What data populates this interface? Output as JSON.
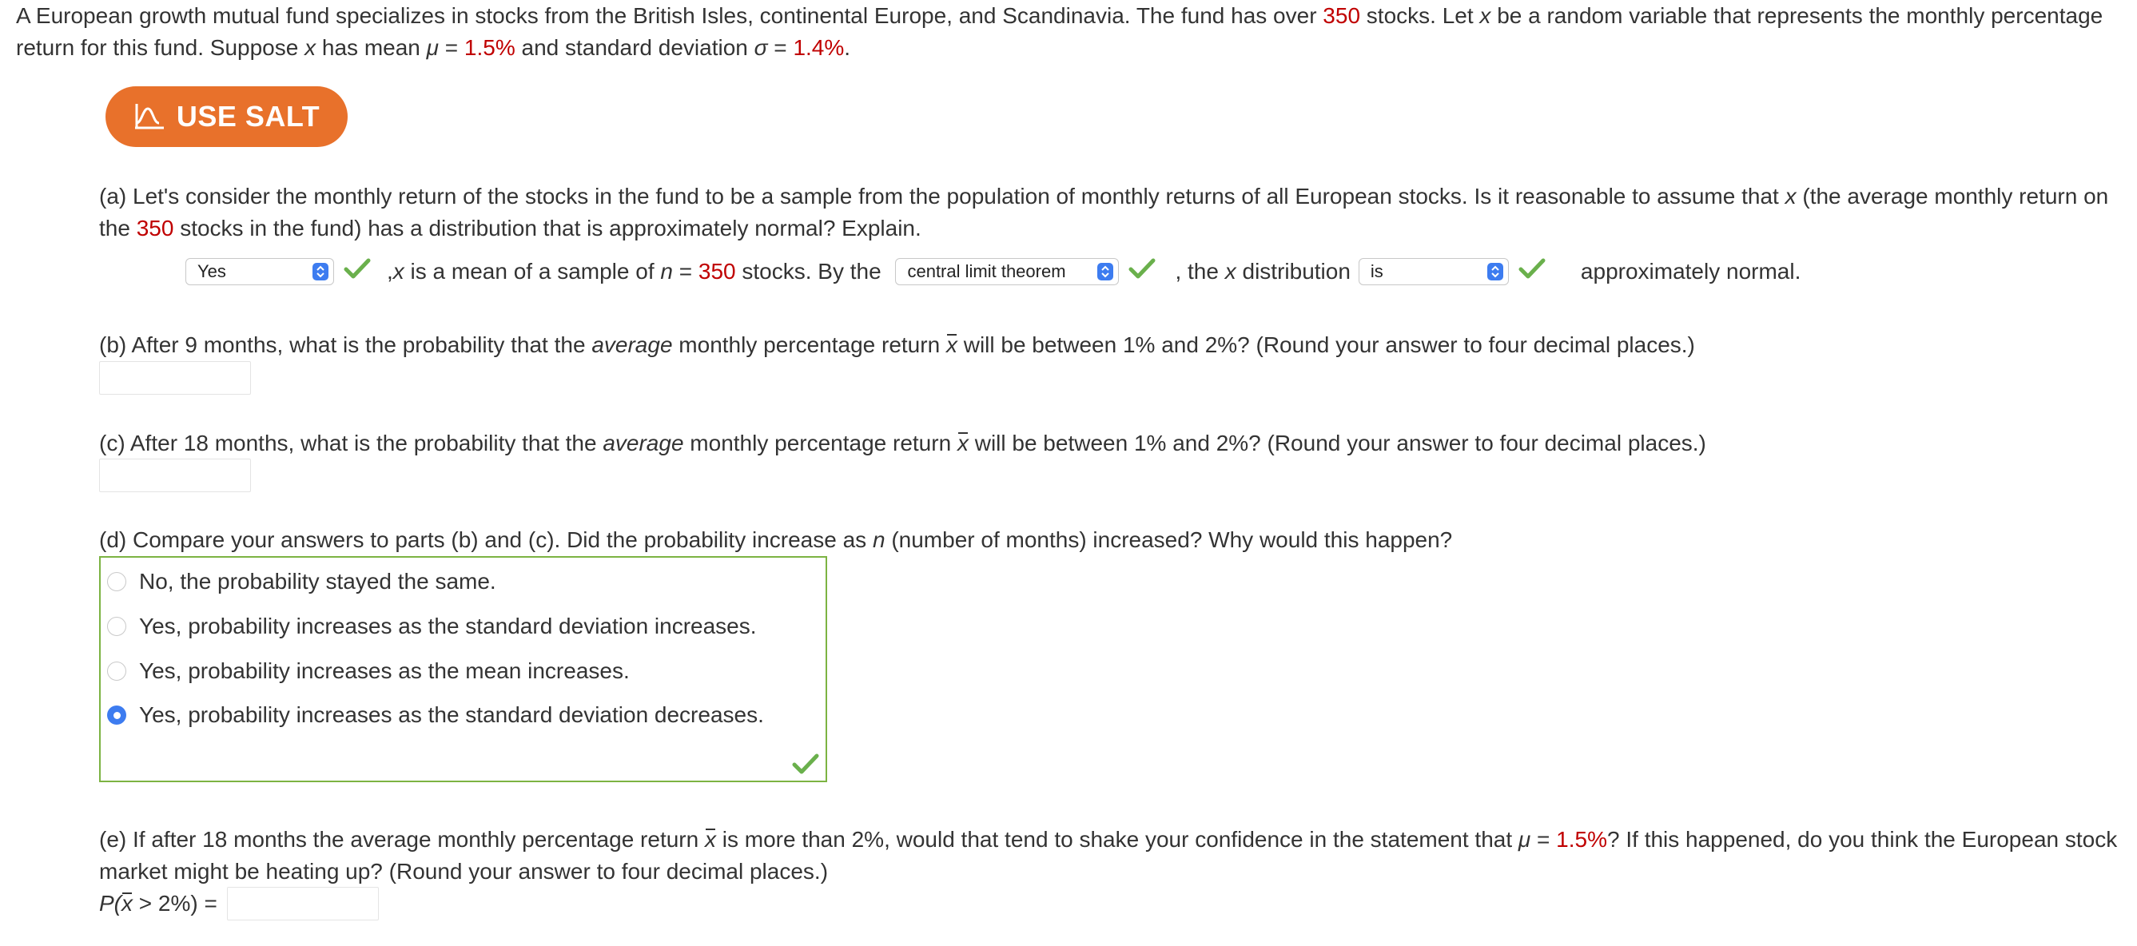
{
  "intro": {
    "t1": "A European growth mutual fund specializes in stocks from the British Isles, continental Europe, and Scandinavia. The fund has over ",
    "n": "350",
    "t2": " stocks. Let ",
    "x": "x",
    "t3": " be a random variable that represents the monthly percentage return for this fund. Suppose ",
    "t4": " has mean ",
    "mu": "μ",
    "eq": " = ",
    "mean": "1.5%",
    "t5": " and standard deviation ",
    "sigma": "σ",
    "sd": "1.4%",
    "end": "."
  },
  "salt_button": {
    "label": "USE SALT"
  },
  "part_a": {
    "q1": "(a) Let's consider the monthly return of the stocks in the fund to be a sample from the population of monthly returns of all European stocks. Is it reasonable to assume that ",
    "q2": " (the average monthly return on the ",
    "n": "350",
    "q3": " stocks in the fund) has a distribution that is approximately normal? Explain.",
    "select1": "Yes",
    "mid1": ", ",
    "mid2": " is a mean of a sample of ",
    "nvar": "n",
    "eq": " = ",
    "mid3": " stocks. By the ",
    "select2": "central limit theorem",
    "mid4": ", the ",
    "mid5": " distribution",
    "select3": "is",
    "end": "approximately normal."
  },
  "part_b": {
    "q1": "(b) After 9 months, what is the probability that the ",
    "avg": "average",
    "q2": " monthly percentage return ",
    "xbar": "x",
    "q3": " will be between 1% and 2%? (Round your answer to four decimal places.)",
    "answer": ""
  },
  "part_c": {
    "q1": "(c) After 18 months, what is the probability that the ",
    "avg": "average",
    "q2": " monthly percentage return ",
    "xbar": "x",
    "q3": " will be between 1% and 2%? (Round your answer to four decimal places.)",
    "answer": ""
  },
  "part_d": {
    "q1": "(d) Compare your answers to parts (b) and (c). Did the probability increase as ",
    "nvar": "n",
    "q2": " (number of months) increased? Why would this happen?",
    "options": [
      "No, the probability stayed the same.",
      "Yes, probability increases as the standard deviation increases.",
      "Yes, probability increases as the mean increases.",
      "Yes, probability increases as the standard deviation decreases."
    ],
    "selected_index": 3
  },
  "part_e": {
    "q1": "(e) If after 18 months the average monthly percentage return ",
    "xbar": "x",
    "q2": " is more than 2%, would that tend to shake your confidence in the statement that ",
    "mu": "μ",
    "eq": " = ",
    "mean": "1.5%",
    "q3": "? If this happened, do you think the European stock market might be heating up? (Round your answer to four decimal places.)",
    "p_open": "P(",
    "p_rest": " > 2%) = ",
    "answer": ""
  },
  "colors": {
    "accent_red": "#c00000",
    "salt_orange": "#e8712b",
    "check_green": "#6ab04c",
    "select_blue": "#3d7cf0"
  },
  "icons": [
    "salt-logo-icon",
    "checkmark-icon",
    "select-spinner-icon"
  ]
}
